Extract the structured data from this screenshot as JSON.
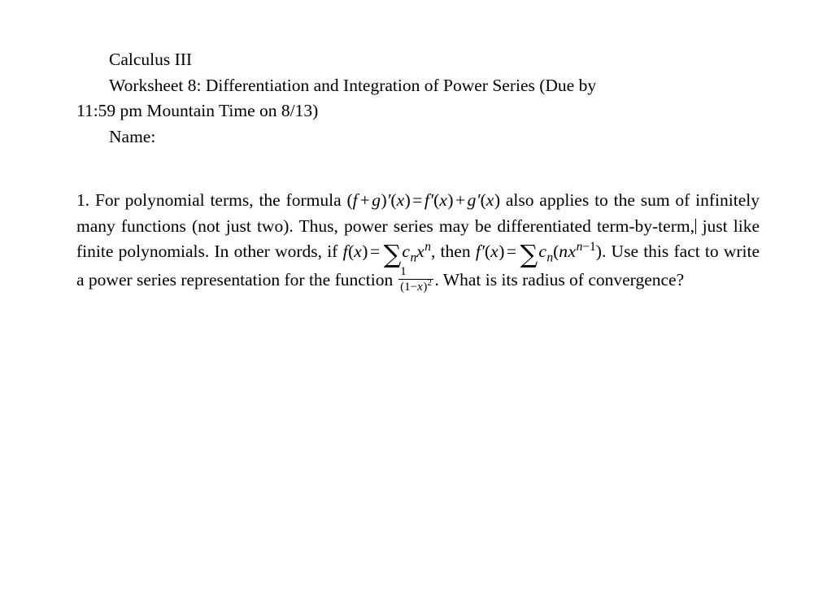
{
  "document": {
    "course": "Calculus III",
    "worksheet_line_1": "Worksheet 8: Differentiation and Integration of Power Series (Due by",
    "worksheet_line_2": "11:59 pm Mountain Time on 8/13)",
    "name_label": "Name:",
    "problem": {
      "number": "1.",
      "text_1": "For polynomial terms, the formula",
      "math_1": "(f + g)'(x) = f'(x) + g'(x)",
      "text_2": "also applies to the sum of infinitely many functions (not just two). Thus, power series may be differentiated term-by-term,",
      "text_3": "just like finite polynomials. In other words, if",
      "math_2": "f(x) = ∑ c_n x^n",
      "text_4": ", then",
      "math_3": "f'(x) = ∑ c_n (n x^{n-1})",
      "text_5": ". Use this fact to write a power series representation for the function",
      "math_4": "1/(1-x)^2",
      "text_6": ". What is its radius of convergence?",
      "tokens": {
        "f": "f",
        "g": "g",
        "x": "x",
        "n": "n",
        "c": "c",
        "plus": "+",
        "minus": "−",
        "equals": "=",
        "prime": "′",
        "sum": "∑",
        "lparen": "(",
        "rparen": ")",
        "comma": ",",
        "period": ".",
        "one": "1",
        "two": "2"
      },
      "fragments": {
        "for_polynomial": "For polynomial terms, the formula",
        "also_applies": "also applies",
        "to_the_sum": "to the sum of infinitely many functions (not just two).",
        "thus_power_series": "Thus, power series",
        "may_be_diff": "may be differentiated term-by-term,",
        "just_like": "just like finite polynomials.",
        "in_other": "In other",
        "words_if": "words, if",
        "then": ", then",
        "use_this_fact": ". Use this fact to write",
        "a_power_series": "a power series representation for the function",
        "what_is_its": ". What is its radius of",
        "convergence": "convergence?"
      }
    }
  },
  "colors": {
    "page_background": "#ffffff",
    "text": "#000000",
    "caret": "#000000"
  }
}
